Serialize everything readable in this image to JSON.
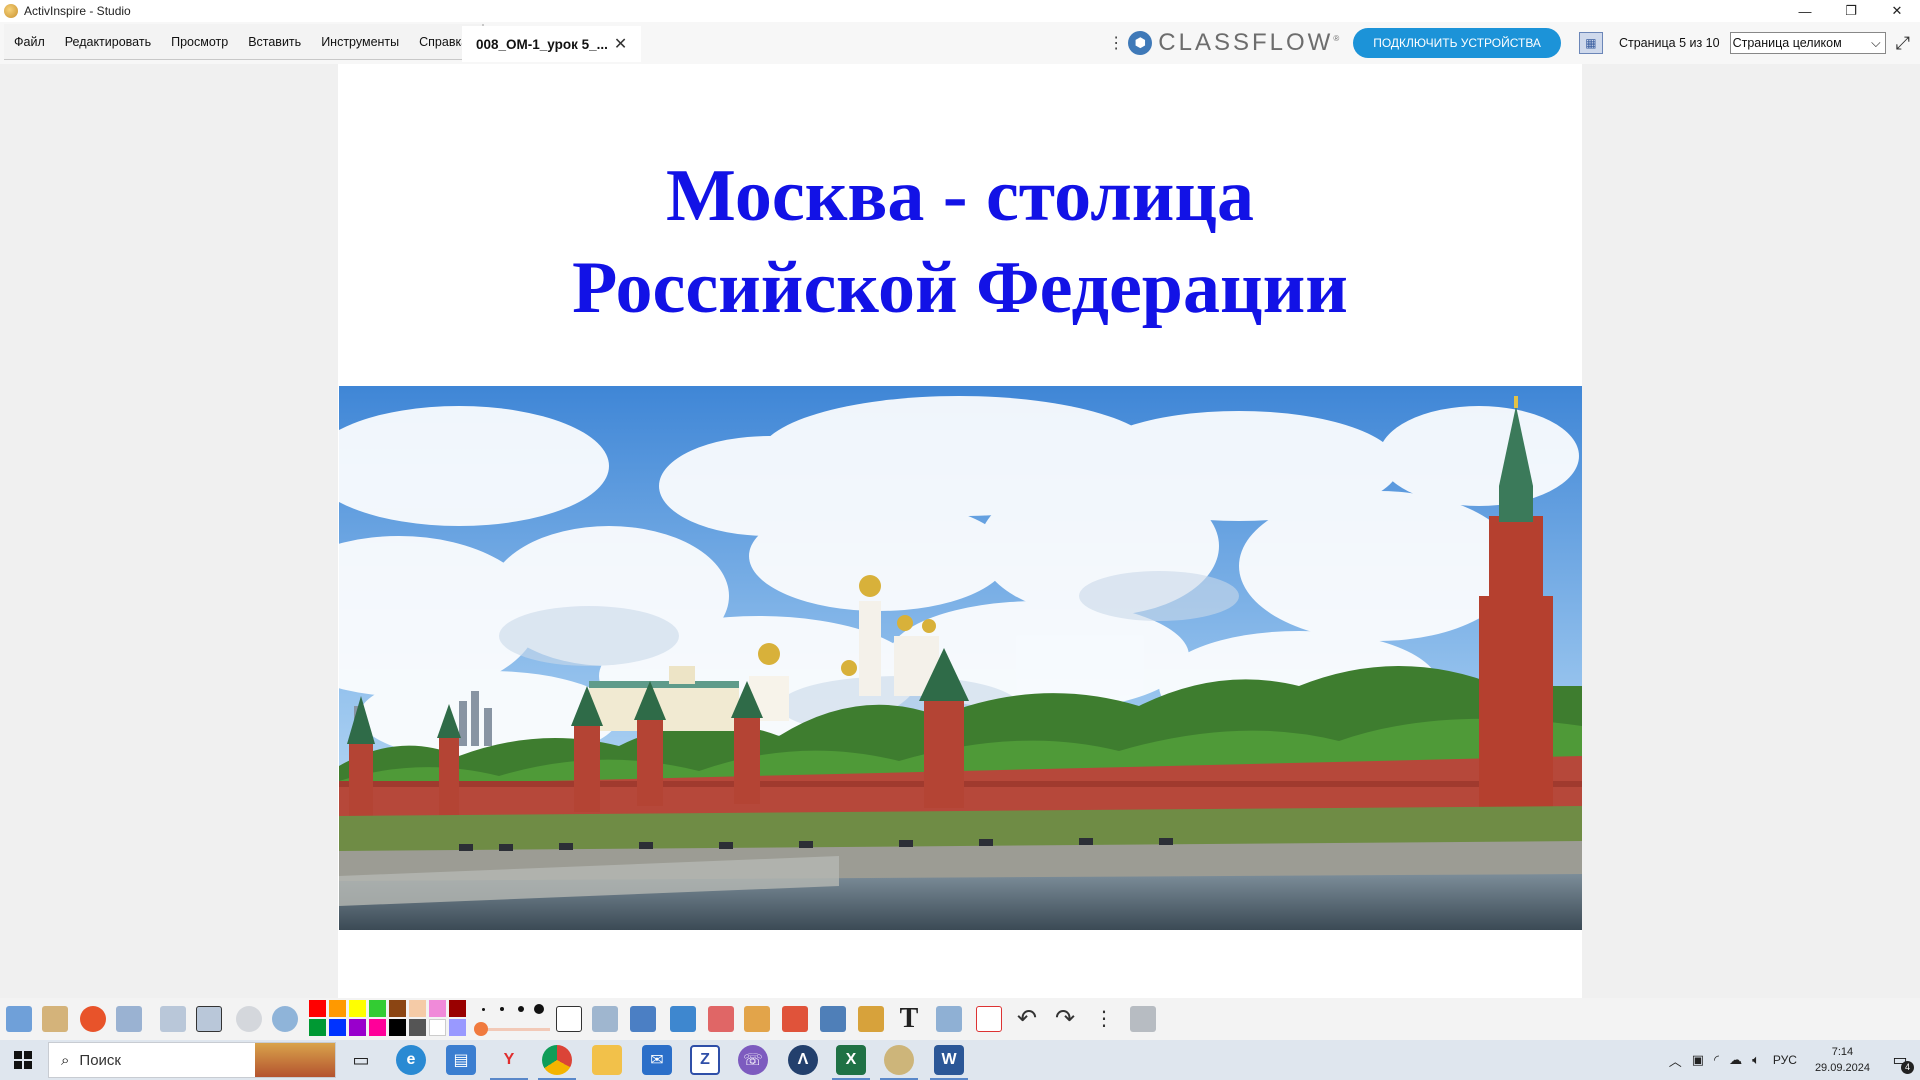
{
  "window": {
    "title": "ActivInspire - Studio",
    "controls": {
      "minimize": "—",
      "restore": "❐",
      "close": "✕"
    }
  },
  "menu": [
    "Файл",
    "Редактировать",
    "Просмотр",
    "Вставить",
    "Инструменты",
    "Справка"
  ],
  "document_tab": {
    "label": "008_ОМ-1_урок 5_...",
    "close_icon": "close-icon"
  },
  "header_right": {
    "classflow_logo_text": "CLASSFLOW",
    "classflow_mark": "®",
    "connect_button": "ПОДКЛЮЧИТЬ УСТРОЙСТВА",
    "page_indicator": "Страница 5 из 10",
    "zoom_select": "Страница целиком"
  },
  "slide": {
    "title_line1": "Москва - столица",
    "title_line2": "Российской Федерации",
    "image": "moscow-kremlin-photo"
  },
  "palette": {
    "colors_top": [
      "#ff0000",
      "#ff9900",
      "#ffff00",
      "#33cc33",
      "#8b4513",
      "#f5cba7",
      "#f08ad9",
      "#990000"
    ],
    "colors_bottom": [
      "#009933",
      "#0033ff",
      "#9900cc",
      "#ff0099",
      "#000000",
      "#555555",
      "#ffffff",
      "#9999ff"
    ]
  },
  "taskbar": {
    "search_placeholder": "Поиск",
    "language": "РУС",
    "time": "7:14",
    "date": "29.09.2024",
    "notifications_count": "4"
  }
}
